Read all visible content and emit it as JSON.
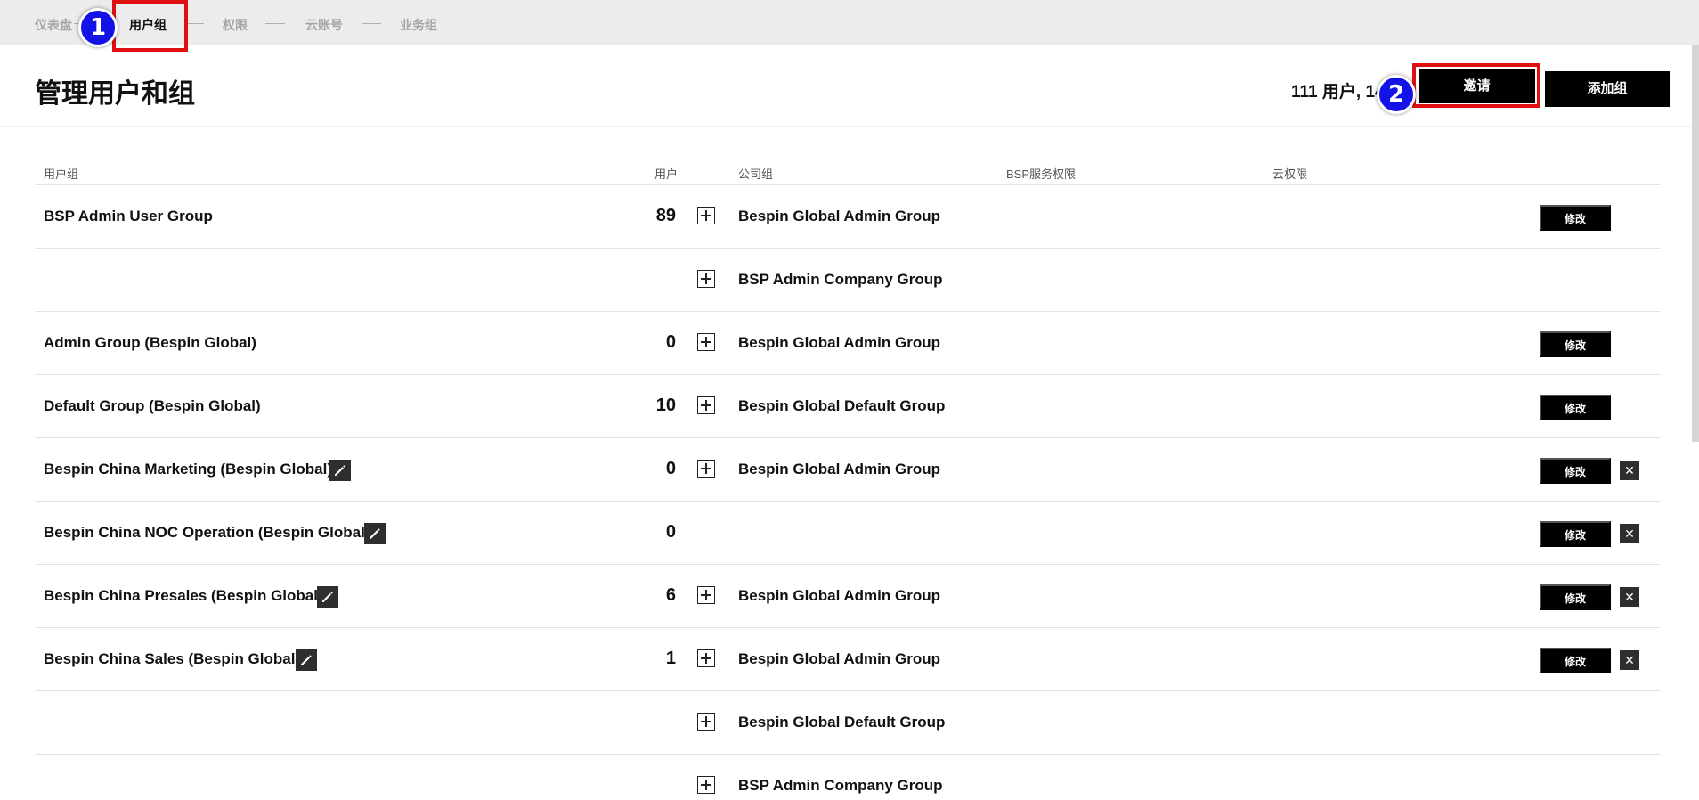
{
  "nav": {
    "items": [
      "仪表盘",
      "用户组",
      "权限",
      "云账号",
      "业务组"
    ],
    "active_index": 1
  },
  "markers": {
    "one": "1",
    "two": "2"
  },
  "header": {
    "title": "管理用户和组",
    "user_count": "111 用户, 14",
    "invite_label": "邀请",
    "add_group_label": "添加组"
  },
  "table": {
    "columns": [
      "用户组",
      "用户",
      "公司组",
      "BSP服务权限",
      "云权限"
    ],
    "edit_label": "修改",
    "delete_glyph": "✕",
    "rows": [
      {
        "group": "BSP Admin User Group",
        "users": "89",
        "company": "Bespin Global Admin Group",
        "editable": true,
        "deletable": false,
        "pencil": false
      },
      {
        "group": "",
        "users": "",
        "company": "BSP Admin Company Group",
        "editable": false,
        "deletable": false,
        "pencil": false
      },
      {
        "group": "Admin Group (Bespin Global)",
        "users": "0",
        "company": "Bespin Global Admin Group",
        "editable": true,
        "deletable": false,
        "pencil": false
      },
      {
        "group": "Default Group (Bespin Global)",
        "users": "10",
        "company": "Bespin Global Default Group",
        "editable": true,
        "deletable": false,
        "pencil": false
      },
      {
        "group": "Bespin China Marketing (Bespin Global)",
        "users": "0",
        "company": "Bespin Global Admin Group",
        "editable": true,
        "deletable": true,
        "pencil": true
      },
      {
        "group": "Bespin China NOC Operation (Bespin Global)",
        "users": "0",
        "company": "",
        "editable": true,
        "deletable": true,
        "pencil": true
      },
      {
        "group": "Bespin China Presales (Bespin Global)",
        "users": "6",
        "company": "Bespin Global Admin Group",
        "editable": true,
        "deletable": true,
        "pencil": true
      },
      {
        "group": "Bespin China Sales (Bespin Global)",
        "users": "1",
        "company": "Bespin Global Admin Group",
        "editable": true,
        "deletable": true,
        "pencil": true
      },
      {
        "group": "",
        "users": "",
        "company": "Bespin Global Default Group",
        "editable": false,
        "deletable": false,
        "pencil": false
      },
      {
        "group": "",
        "users": "",
        "company": "BSP Admin Company Group",
        "editable": false,
        "deletable": false,
        "pencil": false
      }
    ]
  },
  "colors": {
    "marker_blue": "#1313e8",
    "marker_red": "#e01010",
    "button_black": "#000000"
  },
  "icons": {
    "add": "plus-square-icon",
    "edit": "pencil-icon",
    "delete": "close-icon"
  }
}
